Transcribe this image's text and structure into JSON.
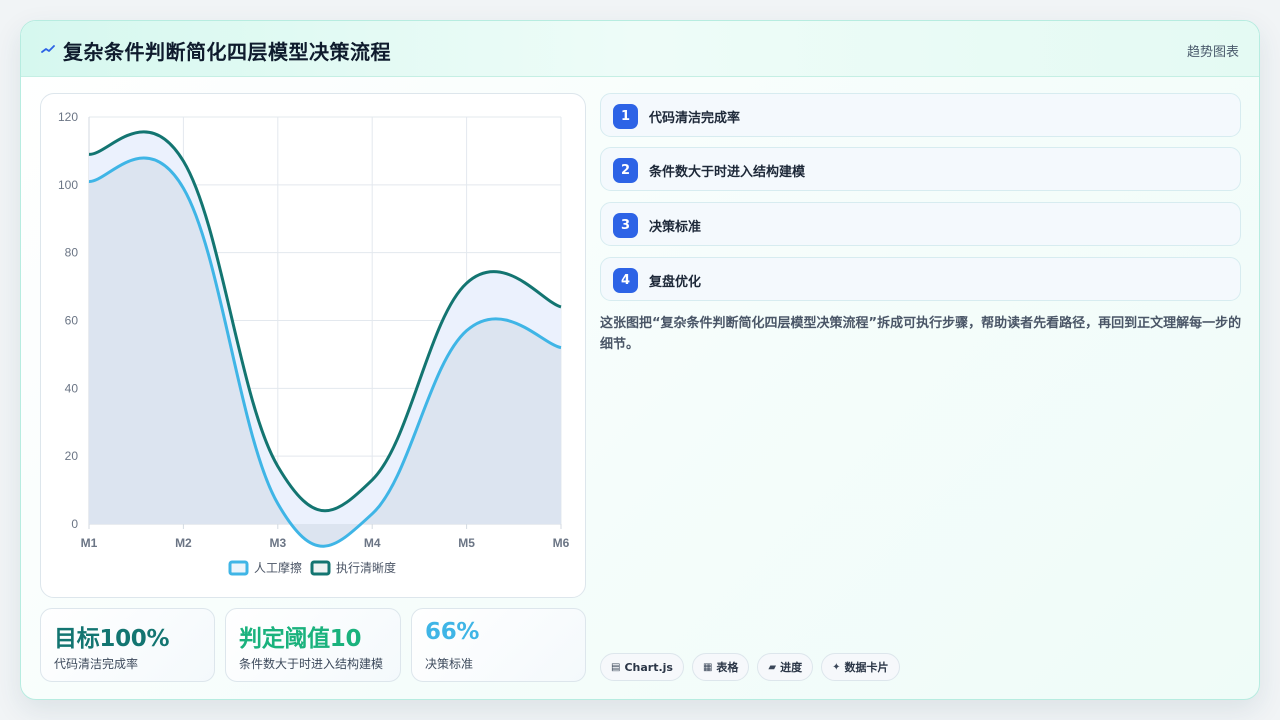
{
  "header": {
    "title": "复杂条件判断简化四层模型决策流程",
    "tag": "趋势图表",
    "icon": "sparkline-icon"
  },
  "chart_data": {
    "type": "area",
    "categories": [
      "M1",
      "M2",
      "M3",
      "M4",
      "M5",
      "M6"
    ],
    "series": [
      {
        "name": "人工摩擦",
        "values": [
          101,
          99,
          6,
          3,
          57,
          52
        ],
        "color": "#3fb5e6"
      },
      {
        "name": "执行清晰度",
        "values": [
          109,
          107,
          17,
          13,
          71,
          64
        ],
        "color": "#137571"
      }
    ],
    "ylim": [
      0,
      120
    ],
    "yticks": [
      0,
      20,
      40,
      60,
      80,
      100,
      120
    ],
    "grid": true,
    "legend": "bottom",
    "title": "",
    "xlabel": "",
    "ylabel": ""
  },
  "kpis": [
    {
      "value": "目标100%",
      "label": "代码清洁完成率",
      "color": "#137571"
    },
    {
      "value": "判定阈值10",
      "label": "条件数大于时进入结构建模",
      "color": "#1ab27d"
    },
    {
      "value": "66%",
      "label": "决策标准",
      "color": "#3fb5e6"
    }
  ],
  "steps": [
    {
      "num": "1",
      "text": "代码清洁完成率"
    },
    {
      "num": "2",
      "text": "条件数大于时进入结构建模"
    },
    {
      "num": "3",
      "text": "决策标准"
    },
    {
      "num": "4",
      "text": "复盘优化"
    }
  ],
  "description": "这张图把“复杂条件判断简化四层模型决策流程”拆成可执行步骤，帮助读者先看路径，再回到正文理解每一步的细节。",
  "chips": [
    {
      "icon": "▤",
      "label": "Chart.js"
    },
    {
      "icon": "▦",
      "label": "表格"
    },
    {
      "icon": "▰",
      "label": "进度"
    },
    {
      "icon": "✦",
      "label": "数据卡片"
    }
  ]
}
